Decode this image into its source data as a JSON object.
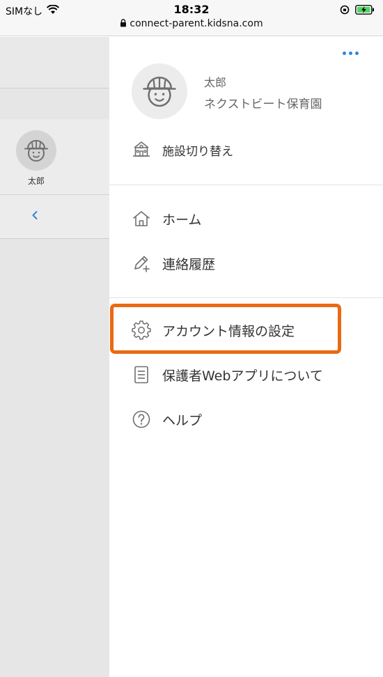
{
  "status_bar": {
    "carrier": "SIMなし",
    "time": "18:32",
    "url": "connect-parent.kidsna.com"
  },
  "side_panel": {
    "child_name": "太郎"
  },
  "drawer": {
    "profile": {
      "name": "太郎",
      "facility": "ネクストビート保育園"
    },
    "switch_facility_label": "施設切り替え",
    "menu_primary": [
      {
        "label": "ホーム",
        "icon": "home-icon"
      },
      {
        "label": "連絡履歴",
        "icon": "pencil-plus-icon"
      }
    ],
    "menu_secondary": [
      {
        "label": "アカウント情報の設定",
        "icon": "gear-icon"
      },
      {
        "label": "保護者Webアプリについて",
        "icon": "document-icon"
      },
      {
        "label": "ヘルプ",
        "icon": "help-icon"
      }
    ]
  },
  "colors": {
    "accent": "#2f86d6",
    "highlight": "#e86a12",
    "icon_gray": "#6e6e6e"
  }
}
